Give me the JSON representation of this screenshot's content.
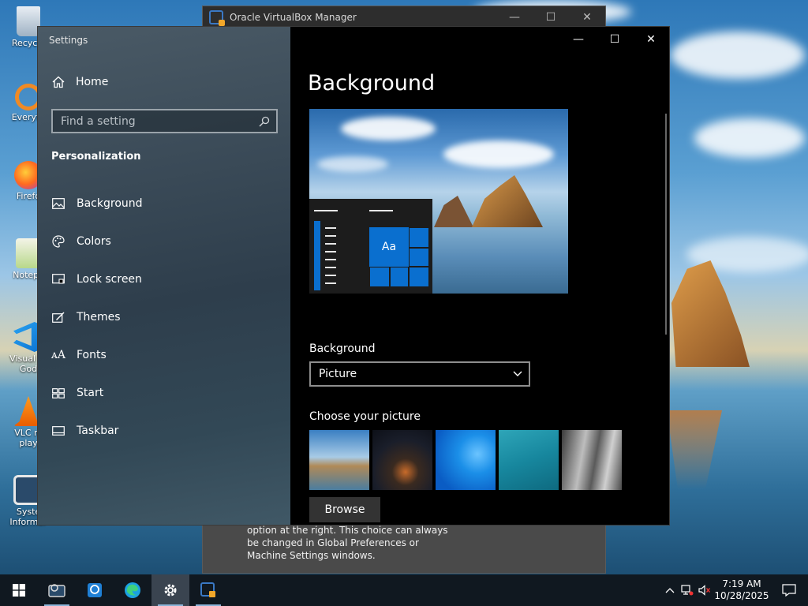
{
  "desktop": {
    "icons": [
      {
        "label": "Recycle"
      },
      {
        "label": "Everyth"
      },
      {
        "label": "Firefo"
      },
      {
        "label": "Notepa"
      },
      {
        "label": "Visual St\nGod"
      },
      {
        "label": "VLC m\nplay"
      },
      {
        "label": "Syste\nInformer"
      }
    ]
  },
  "virtualbox": {
    "title": "Oracle VirtualBox Manager",
    "body_text": "option at the right. This choice can always be changed in Global Preferences or Machine Settings windows."
  },
  "settings": {
    "window_title": "Settings",
    "home_label": "Home",
    "search_placeholder": "Find a setting",
    "section_heading": "Personalization",
    "nav_items": [
      {
        "label": "Background",
        "icon": "picture-icon"
      },
      {
        "label": "Colors",
        "icon": "palette-icon"
      },
      {
        "label": "Lock screen",
        "icon": "lock-screen-icon"
      },
      {
        "label": "Themes",
        "icon": "brush-icon"
      },
      {
        "label": "Fonts",
        "icon": "font-icon"
      },
      {
        "label": "Start",
        "icon": "start-icon"
      },
      {
        "label": "Taskbar",
        "icon": "taskbar-icon"
      }
    ],
    "page_title": "Background",
    "preview_tile_text": "Aa",
    "background_label": "Background",
    "background_value": "Picture",
    "choose_label": "Choose your picture",
    "browse_label": "Browse",
    "accent_color": "#0a6fcf"
  },
  "taskbar": {
    "apps": [
      "start-icon",
      "system-informer-icon",
      "everything-icon",
      "edge-icon",
      "settings-icon",
      "virtualbox-icon"
    ],
    "time": "7:19 AM",
    "date": "10/28/2025"
  }
}
